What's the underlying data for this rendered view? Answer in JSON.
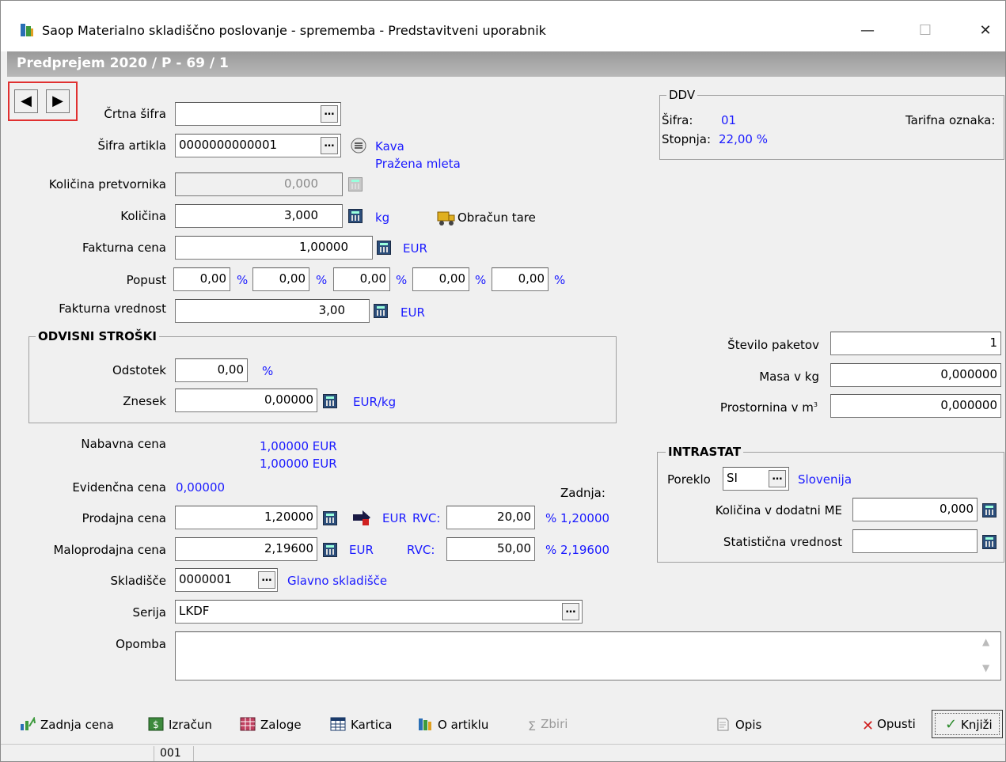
{
  "window": {
    "title": "Saop Materialno skladiščno poslovanje - sprememba - Predstavitveni uporabnik",
    "minimize": "—",
    "maximize": "☐",
    "close": "✕"
  },
  "band": {
    "title": "Predprejem 2020 / P - 69 / 1"
  },
  "nav": {
    "prev": "◀",
    "next": "▶"
  },
  "form": {
    "crtna_sifra_label": "Črtna šifra",
    "crtna_sifra_value": "",
    "sifra_artikla_label": "Šifra artikla",
    "sifra_artikla_value": "0000000000001",
    "artikel_name": "Kava",
    "artikel_desc": "Pražena mleta",
    "kolicina_pretvornika_label": "Količina pretvornika",
    "kolicina_pretvornika_value": "0,000",
    "kolicina_label": "Količina",
    "kolicina_value": "3,000",
    "kolicina_unit": "kg",
    "obracun_tare": "Obračun tare",
    "fakturna_cena_label": "Fakturna cena",
    "fakturna_cena_value": "1,00000",
    "fakturna_cena_unit": "EUR",
    "popust_label": "Popust",
    "popust_values": [
      "0,00",
      "0,00",
      "0,00",
      "0,00",
      "0,00"
    ],
    "percent": "%",
    "fakturna_vrednost_label": "Fakturna vrednost",
    "fakturna_vrednost_value": "3,00",
    "fakturna_vrednost_unit": "EUR"
  },
  "odvisni": {
    "title": "ODVISNI STROŠKI",
    "odstotek_label": "Odstotek",
    "odstotek_value": "0,00",
    "odstotek_unit": "%",
    "znesek_label": "Znesek",
    "znesek_value": "0,00000",
    "znesek_unit": "EUR/kg"
  },
  "cene": {
    "nabavna_label": "Nabavna cena",
    "nabavna_line1": "1,00000 EUR",
    "nabavna_line2": "1,00000 EUR",
    "evidencna_label": "Evidenčna cena",
    "evidencna_value": "0,00000",
    "zadnja_label": "Zadnja:",
    "prodajna_label": "Prodajna cena",
    "prodajna_value": "1,20000",
    "prodajna_unit": "EUR",
    "rvc1_label": "RVC:",
    "rvc1_value": "20,00",
    "rvc1_zadnja": "% 1,20000",
    "maloprodajna_label": "Maloprodajna cena",
    "maloprodajna_value": "2,19600",
    "maloprodajna_unit": "EUR",
    "rvc2_label": "RVC:",
    "rvc2_value": "50,00",
    "rvc2_zadnja": "% 2,19600"
  },
  "skladisce": {
    "label": "Skladišče",
    "value": "0000001",
    "name": "Glavno skladišče"
  },
  "serija": {
    "label": "Serija",
    "value": "LKDF"
  },
  "opomba": {
    "label": "Opomba",
    "value": ""
  },
  "ddv": {
    "title": "DDV",
    "sifra_label": "Šifra:",
    "sifra_value": "01",
    "tarifna_label": "Tarifna oznaka:",
    "stopnja_label": "Stopnja:",
    "stopnja_value": "22,00 %"
  },
  "paketi": {
    "stevilo_label": "Število paketov",
    "stevilo_value": "1",
    "masa_label": "Masa v kg",
    "masa_value": "0,000000",
    "prostornina_label": "Prostornina v m",
    "prostornina_sup": "3",
    "prostornina_value": "0,000000"
  },
  "intrastat": {
    "title": "INTRASTAT",
    "poreklo_label": "Poreklo",
    "poreklo_value": "SI",
    "poreklo_name": "Slovenija",
    "kolicina_label": "Količina v dodatni ME",
    "kolicina_value": "0,000",
    "statisticna_label": "Statistična vrednost",
    "statisticna_value": ""
  },
  "toolbar": {
    "zadnja_cena": "Zadnja cena",
    "izracun": "Izračun",
    "zaloge": "Zaloge",
    "kartica": "Kartica",
    "o_artiklu": "O artiklu",
    "zbiri": "Zbiri",
    "opis": "Opis",
    "opusti": "Opusti",
    "knjizi": "Knjiži"
  },
  "status": {
    "code": "001"
  },
  "colors": {
    "accent": "#1a1aff",
    "band": "#a8a8a8",
    "highlight": "#e03030"
  }
}
